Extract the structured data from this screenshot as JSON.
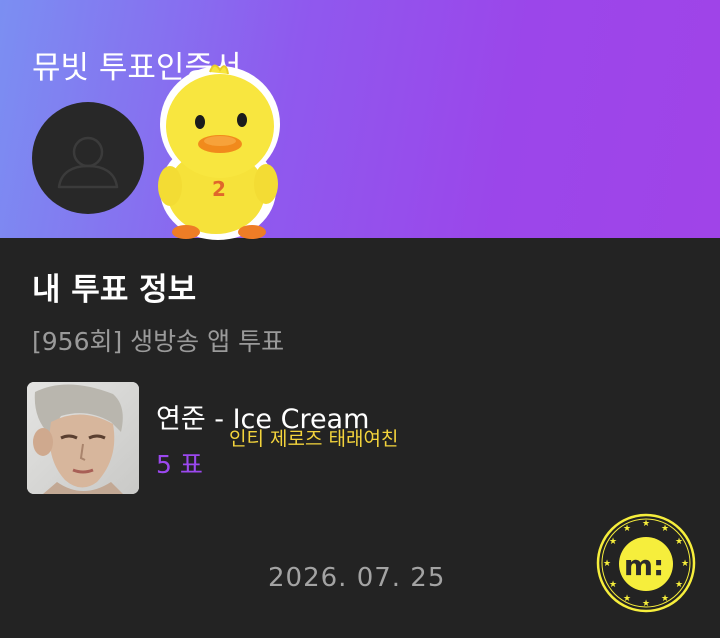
{
  "header": {
    "title": "뮤빗 투표인증서",
    "avatar_icon": "user-silhouette-icon",
    "sticker": "yellow-duck-plush-sticker"
  },
  "vote_info": {
    "heading": "내 투표 정보",
    "round": "[956회] 생방송 앱 투표",
    "song": "연준 - Ice Cream",
    "votes": "5 표",
    "caption": "인티 제로즈 태래여친",
    "date": "2026. 07. 25"
  },
  "badge": {
    "icon": "m-coin-stamp-icon",
    "letter": "m:"
  },
  "colors": {
    "header_gradient_start": "#7b8ff2",
    "header_gradient_end": "#a044e8",
    "background": "#232323",
    "accent_purple": "#9b48ee",
    "caption_yellow": "#f4d43c",
    "badge_yellow": "#f6ee3c"
  }
}
